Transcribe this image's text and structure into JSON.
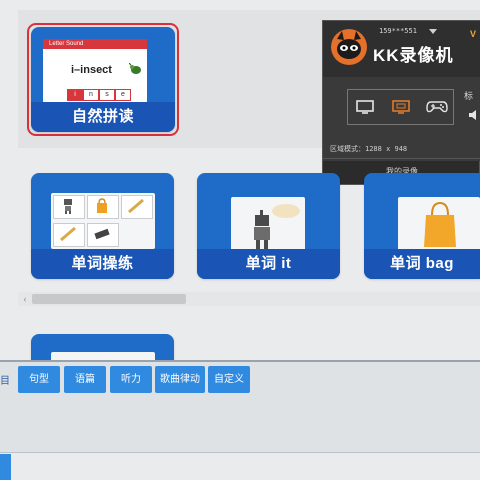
{
  "cards": {
    "phonics": {
      "label": "自然拼读",
      "slide_title": "Letter Sound",
      "word": "i–insect",
      "letters": [
        "i",
        "n",
        "s",
        "e"
      ]
    },
    "word_practice": {
      "label": "单词操练"
    },
    "word_it": {
      "label": "单词 it"
    },
    "word_bag": {
      "label": "单词 bag"
    }
  },
  "recorder": {
    "title": "KK录像机",
    "account": "159***551",
    "version_badge": "V",
    "side_label": "标",
    "region_label": "区域模式：1288 x 948",
    "my_recordings": "我的录像",
    "icons": [
      "monitor-icon",
      "screen-record-icon",
      "gamepad-icon",
      "speaker-icon",
      "dropdown-arrow-icon"
    ],
    "active_mode_color": "#e07a2a"
  },
  "category_tabs": {
    "partial": "目",
    "items": [
      "句型",
      "语篇",
      "听力",
      "歌曲律动",
      "自定义"
    ]
  },
  "colors": {
    "card_blue": "#1e6cc7",
    "caption_blue": "#1a55b6",
    "tab_blue": "#2f8ae0",
    "selection_red": "#d9303a"
  }
}
